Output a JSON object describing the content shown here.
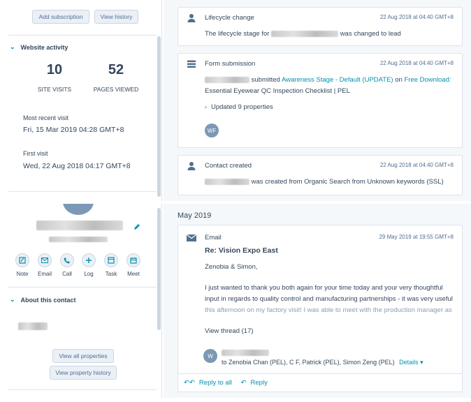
{
  "top": {
    "buttons": {
      "add_subscription": "Add subscription",
      "view_history": "View history"
    },
    "website_activity": {
      "title": "Website activity",
      "site_visits_value": "10",
      "site_visits_label": "SITE VISITS",
      "pages_viewed_value": "52",
      "pages_viewed_label": "PAGES VIEWED",
      "most_recent_label": "Most recent visit",
      "most_recent_value": "Fri, 15 Mar 2019 04:28 GMT+8",
      "first_visit_label": "First visit",
      "first_visit_value": "Wed, 22 Aug 2018 04:17 GMT+8"
    },
    "timeline": {
      "lifecycle": {
        "title": "Lifecycle change",
        "date": "22 Aug 2018 at 04:40 GMT+8",
        "body_pre": "The lifecycle stage for",
        "body_post": "was changed to lead"
      },
      "form": {
        "title": "Form submission",
        "date": "22 Aug 2018 at 04:40 GMT+8",
        "submitted": "submitted",
        "form_name": "Awareness Stage - Default (UPDATE)",
        "on": "on",
        "page_line1": "Free Download:",
        "page_line2": "Essential Eyewear QC Inspection Checklist | PEL",
        "updated": "Updated 9 properties",
        "avatar_initials": "WF"
      },
      "contact_created": {
        "title": "Contact created",
        "date": "22 Aug 2018 at 04:40 GMT+8",
        "body": "was created from Organic Search from Unknown keywords (SSL)"
      }
    }
  },
  "bottom": {
    "actions": [
      "Note",
      "Email",
      "Call",
      "Log",
      "Task",
      "Meet"
    ],
    "about_title": "About this contact",
    "view_all_properties": "View all properties",
    "view_property_history": "View property history",
    "month": "May 2019",
    "email": {
      "type": "Email",
      "date": "29 May 2019 at 19:55 GMT+8",
      "subject": "Re: Vision Expo East",
      "greeting": "Zenobia & Simon,",
      "body_line1": "I just wanted to thank you both again for your time today and your very thoughtful",
      "body_line2": "input in regards to quality control and manufacturing partnerships - it was very useful",
      "body_line3": "this afternoon on my factory visit! I was able to meet with the production manager as",
      "view_thread": "View thread (17)",
      "avatar_initials": "W",
      "recipients": "to Zenobia Chan (PEL), C F, Patrick (PEL), Simon Zeng (PEL)",
      "details": "Details",
      "reply_all": "Reply to all",
      "reply": "Reply"
    }
  },
  "colors": {
    "link": "#0091ae",
    "text": "#33475b",
    "border": "#dfe3eb",
    "avatar": "#7c98b6"
  }
}
